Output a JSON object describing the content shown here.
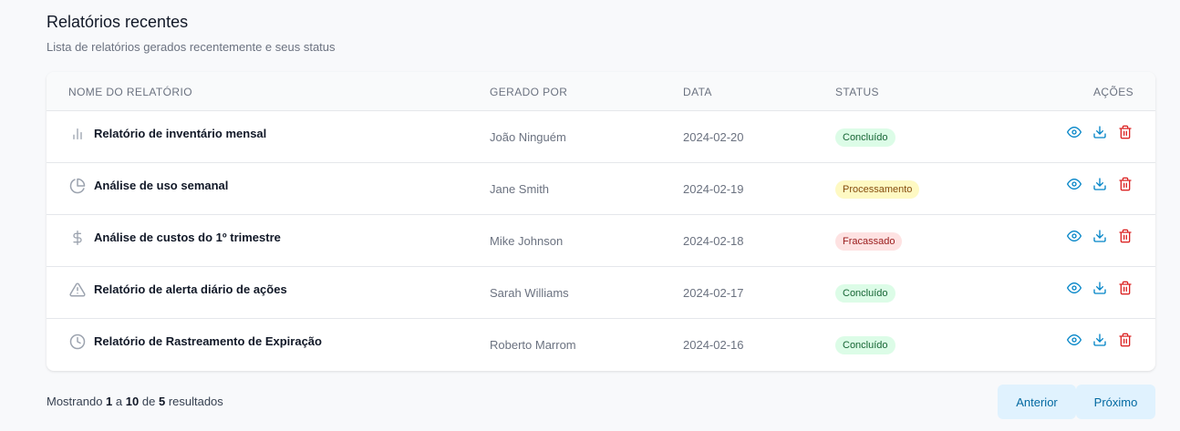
{
  "header": {
    "title": "Relatórios recentes",
    "subtitle": "Lista de relatórios gerados recentemente e seus status"
  },
  "table": {
    "columns": {
      "name": "NOME DO RELATÓRIO",
      "by": "GERADO POR",
      "date": "DATA",
      "status": "STATUS",
      "actions": "AÇÕES"
    },
    "rows": [
      {
        "icon": "bar-chart-icon",
        "name": "Relatório de inventário mensal",
        "by": "João Ninguém",
        "date": "2024-02-20",
        "status": "Concluído",
        "status_kind": "success"
      },
      {
        "icon": "pie-chart-icon",
        "name": "Análise de uso semanal",
        "by": "Jane Smith",
        "date": "2024-02-19",
        "status": "Processamento",
        "status_kind": "warning"
      },
      {
        "icon": "dollar-icon",
        "name": "Análise de custos do 1º trimestre",
        "by": "Mike Johnson",
        "date": "2024-02-18",
        "status": "Fracassado",
        "status_kind": "error"
      },
      {
        "icon": "alert-triangle-icon",
        "name": "Relatório de alerta diário de ações",
        "by": "Sarah Williams",
        "date": "2024-02-17",
        "status": "Concluído",
        "status_kind": "success"
      },
      {
        "icon": "clock-icon",
        "name": "Relatório de Rastreamento de Expiração",
        "by": "Roberto Marrom",
        "date": "2024-02-16",
        "status": "Concluído",
        "status_kind": "success"
      }
    ]
  },
  "footer": {
    "showing": "Mostrando",
    "from": "1",
    "to_word": "a",
    "to": "10",
    "of_word": "de",
    "total": "5",
    "results": "resultados",
    "prev_label": "Anterior",
    "next_label": "Próximo"
  },
  "colors": {
    "success_bg": "#dcfce7",
    "success_fg": "#166534",
    "warning_bg": "#fef9c3",
    "warning_fg": "#854d0e",
    "error_bg": "#fee2e2",
    "error_fg": "#991b1b",
    "view_icon": "#0284c7",
    "download_icon": "#0284c7",
    "delete_icon": "#dc2626"
  }
}
